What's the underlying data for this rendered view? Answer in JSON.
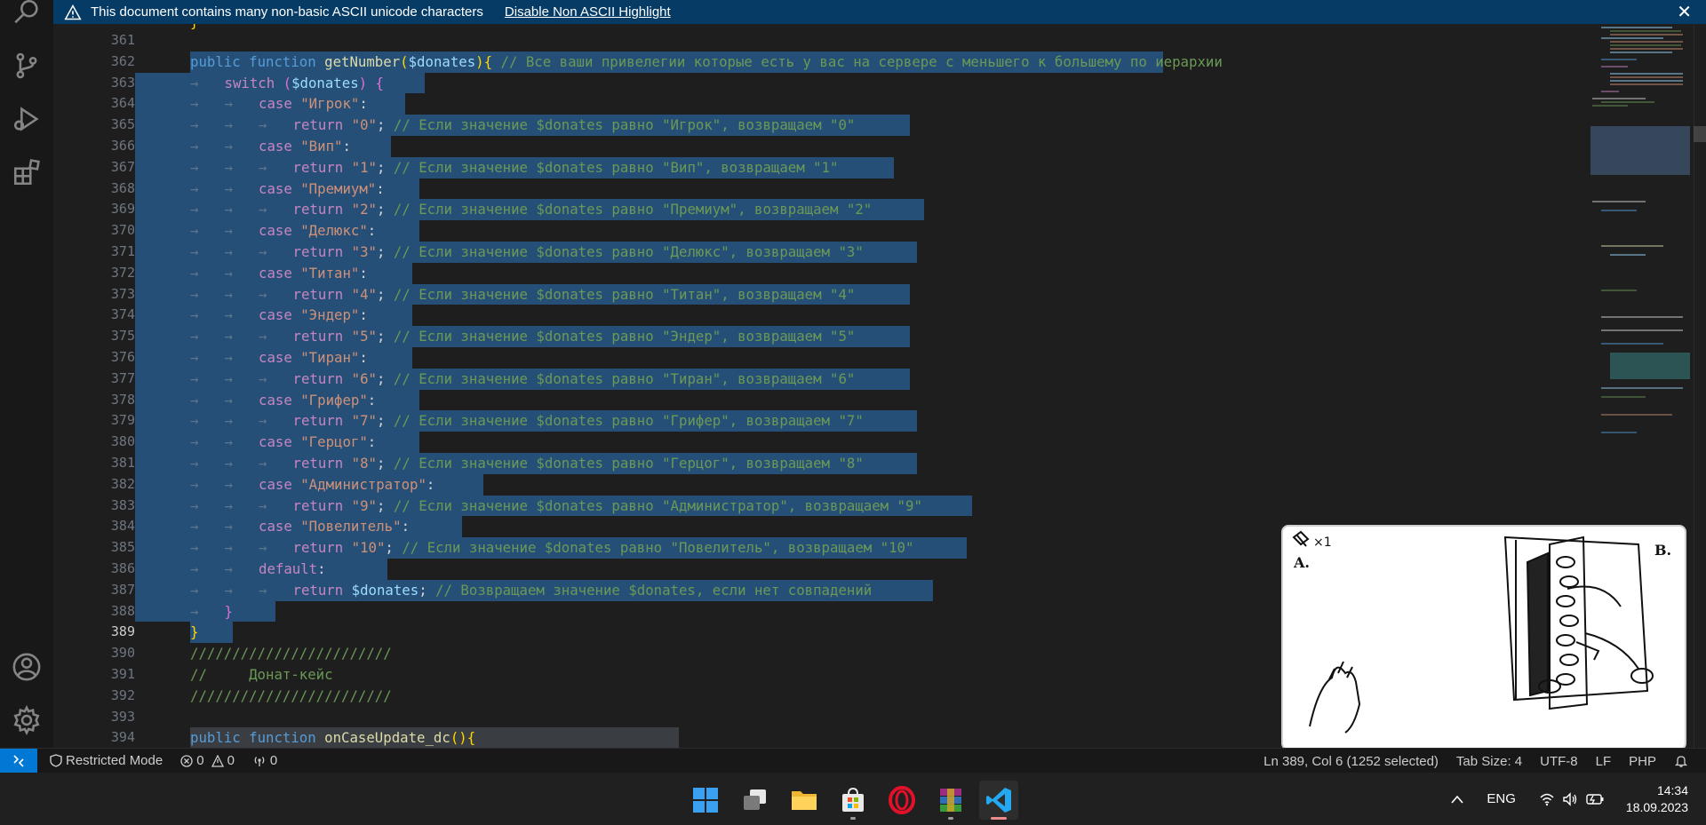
{
  "banner": {
    "message": "This document contains many non-basic ASCII unicode characters",
    "action": "Disable Non ASCII Highlight",
    "close": "✕"
  },
  "editor": {
    "partial_top_line": "}",
    "lines": [
      {
        "n": "361",
        "code": []
      },
      {
        "n": "362",
        "indent": 1,
        "sel": 1095,
        "code": [
          [
            "kw",
            "public"
          ],
          [
            "sp",
            " "
          ],
          [
            "kw",
            "function"
          ],
          [
            "sp",
            " "
          ],
          [
            "fn",
            "getNumber"
          ],
          [
            "br1",
            "("
          ],
          [
            "var",
            "$donates"
          ],
          [
            "br1",
            ")"
          ],
          [
            "br1",
            "{"
          ],
          [
            "sp",
            " "
          ],
          [
            "cm",
            "// Все ваши привелегии которые есть у вас на сервере с меньшего к большему по иерархии"
          ]
        ]
      },
      {
        "n": "363",
        "indent": 2,
        "sel": 264,
        "code": [
          [
            "ctl",
            "switch"
          ],
          [
            "sp",
            " "
          ],
          [
            "br2",
            "("
          ],
          [
            "var",
            "$donates"
          ],
          [
            "br2",
            ")"
          ],
          [
            "sp",
            " "
          ],
          [
            "br2",
            "{"
          ]
        ]
      },
      {
        "n": "364",
        "indent": 3,
        "sel": 242,
        "code": [
          [
            "ctl",
            "case"
          ],
          [
            "sp",
            " "
          ],
          [
            "str",
            "\"Игрок\""
          ],
          [
            "pl",
            ":"
          ]
        ]
      },
      {
        "n": "365",
        "indent": 4,
        "sel": 810,
        "code": [
          [
            "ctl",
            "return"
          ],
          [
            "sp",
            " "
          ],
          [
            "str",
            "\"0\""
          ],
          [
            "pl",
            ";"
          ],
          [
            "sp",
            " "
          ],
          [
            "cm",
            "// Если значение $donates равно \"Игрок\", возвращаем \"0\""
          ]
        ]
      },
      {
        "n": "366",
        "indent": 3,
        "sel": 226,
        "code": [
          [
            "ctl",
            "case"
          ],
          [
            "sp",
            " "
          ],
          [
            "str",
            "\"Вип\""
          ],
          [
            "pl",
            ":"
          ]
        ]
      },
      {
        "n": "367",
        "indent": 4,
        "sel": 792,
        "code": [
          [
            "ctl",
            "return"
          ],
          [
            "sp",
            " "
          ],
          [
            "str",
            "\"1\""
          ],
          [
            "pl",
            ";"
          ],
          [
            "sp",
            " "
          ],
          [
            "cm",
            "// Если значение $donates равно \"Вип\", возвращаем \"1\""
          ]
        ]
      },
      {
        "n": "368",
        "indent": 3,
        "sel": 258,
        "code": [
          [
            "ctl",
            "case"
          ],
          [
            "sp",
            " "
          ],
          [
            "str",
            "\"Премиум\""
          ],
          [
            "pl",
            ":"
          ]
        ]
      },
      {
        "n": "369",
        "indent": 4,
        "sel": 826,
        "code": [
          [
            "ctl",
            "return"
          ],
          [
            "sp",
            " "
          ],
          [
            "str",
            "\"2\""
          ],
          [
            "pl",
            ";"
          ],
          [
            "sp",
            " "
          ],
          [
            "cm",
            "// Если значение $donates равно \"Премиум\", возвращаем \"2\""
          ]
        ]
      },
      {
        "n": "370",
        "indent": 3,
        "sel": 258,
        "code": [
          [
            "ctl",
            "case"
          ],
          [
            "sp",
            " "
          ],
          [
            "str",
            "\"Делюкс\""
          ],
          [
            "pl",
            ":"
          ]
        ]
      },
      {
        "n": "371",
        "indent": 4,
        "sel": 818,
        "code": [
          [
            "ctl",
            "return"
          ],
          [
            "sp",
            " "
          ],
          [
            "str",
            "\"3\""
          ],
          [
            "pl",
            ";"
          ],
          [
            "sp",
            " "
          ],
          [
            "cm",
            "// Если значение $donates равно \"Делюкс\", возвращаем \"3\""
          ]
        ]
      },
      {
        "n": "372",
        "indent": 3,
        "sel": 250,
        "code": [
          [
            "ctl",
            "case"
          ],
          [
            "sp",
            " "
          ],
          [
            "str",
            "\"Титан\""
          ],
          [
            "pl",
            ":"
          ]
        ]
      },
      {
        "n": "373",
        "indent": 4,
        "sel": 810,
        "code": [
          [
            "ctl",
            "return"
          ],
          [
            "sp",
            " "
          ],
          [
            "str",
            "\"4\""
          ],
          [
            "pl",
            ";"
          ],
          [
            "sp",
            " "
          ],
          [
            "cm",
            "// Если значение $donates равно \"Титан\", возвращаем \"4\""
          ]
        ]
      },
      {
        "n": "374",
        "indent": 3,
        "sel": 250,
        "code": [
          [
            "ctl",
            "case"
          ],
          [
            "sp",
            " "
          ],
          [
            "str",
            "\"Эндер\""
          ],
          [
            "pl",
            ":"
          ]
        ]
      },
      {
        "n": "375",
        "indent": 4,
        "sel": 810,
        "code": [
          [
            "ctl",
            "return"
          ],
          [
            "sp",
            " "
          ],
          [
            "str",
            "\"5\""
          ],
          [
            "pl",
            ";"
          ],
          [
            "sp",
            " "
          ],
          [
            "cm",
            "// Если значение $donates равно \"Эндер\", возвращаем \"5\""
          ]
        ]
      },
      {
        "n": "376",
        "indent": 3,
        "sel": 250,
        "code": [
          [
            "ctl",
            "case"
          ],
          [
            "sp",
            " "
          ],
          [
            "str",
            "\"Тиран\""
          ],
          [
            "pl",
            ":"
          ]
        ]
      },
      {
        "n": "377",
        "indent": 4,
        "sel": 810,
        "code": [
          [
            "ctl",
            "return"
          ],
          [
            "sp",
            " "
          ],
          [
            "str",
            "\"6\""
          ],
          [
            "pl",
            ";"
          ],
          [
            "sp",
            " "
          ],
          [
            "cm",
            "// Если значение $donates равно \"Тиран\", возвращаем \"6\""
          ]
        ]
      },
      {
        "n": "378",
        "indent": 3,
        "sel": 258,
        "code": [
          [
            "ctl",
            "case"
          ],
          [
            "sp",
            " "
          ],
          [
            "str",
            "\"Грифер\""
          ],
          [
            "pl",
            ":"
          ]
        ]
      },
      {
        "n": "379",
        "indent": 4,
        "sel": 818,
        "code": [
          [
            "ctl",
            "return"
          ],
          [
            "sp",
            " "
          ],
          [
            "str",
            "\"7\""
          ],
          [
            "pl",
            ";"
          ],
          [
            "sp",
            " "
          ],
          [
            "cm",
            "// Если значение $donates равно \"Грифер\", возвращаем \"7\""
          ]
        ]
      },
      {
        "n": "380",
        "indent": 3,
        "sel": 258,
        "code": [
          [
            "ctl",
            "case"
          ],
          [
            "sp",
            " "
          ],
          [
            "str",
            "\"Герцог\""
          ],
          [
            "pl",
            ":"
          ]
        ]
      },
      {
        "n": "381",
        "indent": 4,
        "sel": 818,
        "code": [
          [
            "ctl",
            "return"
          ],
          [
            "sp",
            " "
          ],
          [
            "str",
            "\"8\""
          ],
          [
            "pl",
            ";"
          ],
          [
            "sp",
            " "
          ],
          [
            "cm",
            "// Если значение $donates равно \"Герцог\", возвращаем \"8\""
          ]
        ]
      },
      {
        "n": "382",
        "indent": 3,
        "sel": 330,
        "code": [
          [
            "ctl",
            "case"
          ],
          [
            "sp",
            " "
          ],
          [
            "str",
            "\"Администратор\""
          ],
          [
            "pl",
            ":"
          ]
        ]
      },
      {
        "n": "383",
        "indent": 4,
        "sel": 880,
        "code": [
          [
            "ctl",
            "return"
          ],
          [
            "sp",
            " "
          ],
          [
            "str",
            "\"9\""
          ],
          [
            "pl",
            ";"
          ],
          [
            "sp",
            " "
          ],
          [
            "cm",
            "// Если значение $donates равно \"Администратор\", возвращаем \"9\""
          ]
        ]
      },
      {
        "n": "384",
        "indent": 3,
        "sel": 306,
        "code": [
          [
            "ctl",
            "case"
          ],
          [
            "sp",
            " "
          ],
          [
            "str",
            "\"Повелитель\""
          ],
          [
            "pl",
            ":"
          ]
        ]
      },
      {
        "n": "385",
        "indent": 4,
        "sel": 874,
        "code": [
          [
            "ctl",
            "return"
          ],
          [
            "sp",
            " "
          ],
          [
            "str",
            "\"10\""
          ],
          [
            "pl",
            ";"
          ],
          [
            "sp",
            " "
          ],
          [
            "cm",
            "// Если значение $donates равно \"Повелитель\", возвращаем \"10\""
          ]
        ]
      },
      {
        "n": "386",
        "indent": 3,
        "sel": 222,
        "code": [
          [
            "ctl",
            "default"
          ],
          [
            "pl",
            ":"
          ]
        ]
      },
      {
        "n": "387",
        "indent": 4,
        "sel": 836,
        "code": [
          [
            "ctl",
            "return"
          ],
          [
            "sp",
            " "
          ],
          [
            "var",
            "$donates"
          ],
          [
            "pl",
            ";"
          ],
          [
            "sp",
            " "
          ],
          [
            "cm",
            "// Возвращаем значение $donates, если нет совпадений"
          ]
        ]
      },
      {
        "n": "388",
        "indent": 2,
        "sel": 96,
        "code": [
          [
            "br2",
            "}"
          ]
        ]
      },
      {
        "n": "389",
        "indent": 1,
        "sel": 48,
        "active": true,
        "code": [
          [
            "br1",
            "}"
          ]
        ]
      },
      {
        "n": "390",
        "indent": 0,
        "code": [
          [
            "cm",
            "////////////////////////"
          ]
        ]
      },
      {
        "n": "391",
        "indent": 0,
        "code": [
          [
            "cm",
            "//     Донат-кейс"
          ]
        ]
      },
      {
        "n": "392",
        "indent": 0,
        "code": [
          [
            "cm",
            "////////////////////////"
          ]
        ]
      },
      {
        "n": "393",
        "code": []
      },
      {
        "n": "394",
        "indent": 1,
        "hl": true,
        "code": [
          [
            "kw",
            "public"
          ],
          [
            "sp",
            " "
          ],
          [
            "kw",
            "function"
          ],
          [
            "sp",
            " "
          ],
          [
            "fn",
            "onCaseUpdate_dc"
          ],
          [
            "br1",
            "("
          ],
          [
            "br1",
            ")"
          ],
          [
            "br1",
            "{"
          ]
        ]
      }
    ]
  },
  "status": {
    "restricted": "Restricted Mode",
    "errors": "0",
    "warnings": "0",
    "ports": "0",
    "position": "Ln 389, Col 6 (1252 selected)",
    "tab_size": "Tab Size: 4",
    "encoding": "UTF-8",
    "eol": "LF",
    "language": "PHP"
  },
  "sketch": {
    "label_a": "A.",
    "label_b": "B.",
    "counter": "×1"
  },
  "taskbar": {
    "lang": "ENG",
    "time": "14:34",
    "date": "18.09.2023"
  },
  "colors": {
    "selection": "#264f78",
    "banner": "#063b65",
    "remote": "#0078d4"
  }
}
